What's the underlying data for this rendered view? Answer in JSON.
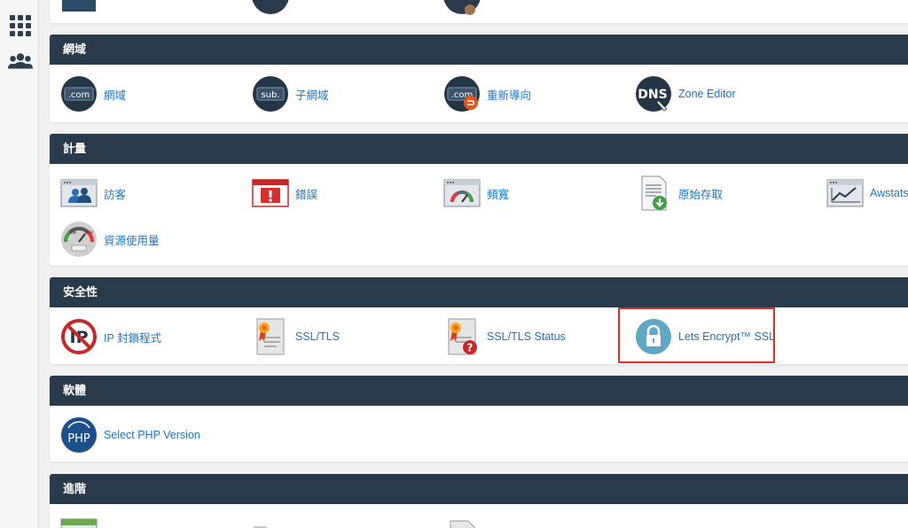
{
  "sidebar": {
    "items": [
      {
        "name": "apps-grid-icon"
      },
      {
        "name": "users-icon"
      }
    ]
  },
  "colors": {
    "header_bg": "#293a4a",
    "link": "#1e73be",
    "highlight": "#e62c1f"
  },
  "top_partial": {
    "items": [
      {
        "icon": "partial-icon-1"
      },
      {
        "icon": "partial-icon-2"
      },
      {
        "icon": "partial-icon-3"
      }
    ]
  },
  "domains": {
    "title": "網域",
    "items": [
      {
        "label": "網域",
        "icon": "dot-com-icon"
      },
      {
        "label": "子網域",
        "icon": "subdomain-icon"
      },
      {
        "label": "重新導向",
        "icon": "redirect-icon"
      },
      {
        "label": "Zone Editor",
        "icon": "dns-zone-editor-icon"
      }
    ]
  },
  "metrics": {
    "title": "計量",
    "items": [
      {
        "label": "訪客",
        "icon": "visitors-icon"
      },
      {
        "label": "錯誤",
        "icon": "errors-icon"
      },
      {
        "label": "頻寬",
        "icon": "bandwidth-icon"
      },
      {
        "label": "原始存取",
        "icon": "raw-access-icon"
      },
      {
        "label": "Awstats",
        "icon": "awstats-icon"
      },
      {
        "label": "資源使用量",
        "icon": "resource-usage-icon"
      }
    ]
  },
  "security": {
    "title": "安全性",
    "items": [
      {
        "label": "IP 封鎖程式",
        "icon": "ip-blocker-icon"
      },
      {
        "label": "SSL/TLS",
        "icon": "ssl-certificate-icon"
      },
      {
        "label": "SSL/TLS Status",
        "icon": "ssl-status-icon"
      },
      {
        "label": "Lets Encrypt™ SSL",
        "icon": "lock-icon",
        "highlighted": true
      }
    ]
  },
  "software": {
    "title": "軟體",
    "items": [
      {
        "label": "Select PHP Version",
        "icon": "php-icon"
      }
    ]
  },
  "advanced": {
    "title": "進階",
    "items": [
      {
        "icon": "advanced-icon-1"
      },
      {
        "icon": "advanced-icon-2"
      },
      {
        "icon": "advanced-icon-3"
      }
    ]
  }
}
